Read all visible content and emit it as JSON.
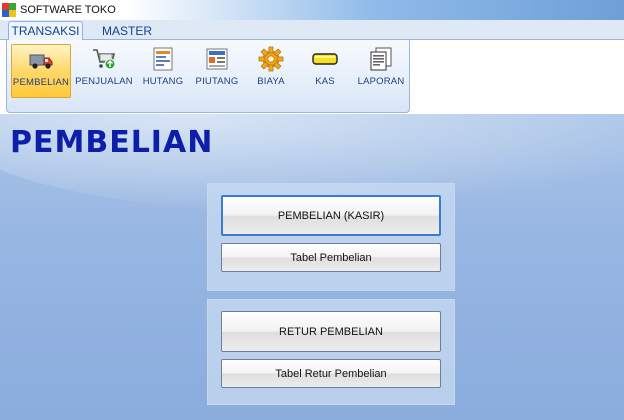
{
  "window": {
    "title": "SOFTWARE TOKO"
  },
  "tabs": [
    {
      "label": "TRANSAKSI",
      "active": true
    },
    {
      "label": "MASTER",
      "active": false
    }
  ],
  "ribbon": {
    "items": [
      {
        "label": "PEMBELIAN",
        "icon": "delivery-truck-icon",
        "active": true
      },
      {
        "label": "PENJUALAN",
        "icon": "shopping-cart-icon",
        "active": false
      },
      {
        "label": "HUTANG",
        "icon": "ledger-document-icon",
        "active": false
      },
      {
        "label": "PIUTANG",
        "icon": "receivable-card-icon",
        "active": false
      },
      {
        "label": "BIAYA",
        "icon": "gear-icon",
        "active": false
      },
      {
        "label": "KAS",
        "icon": "cash-bar-icon",
        "active": false
      },
      {
        "label": "LAPORAN",
        "icon": "report-pages-icon",
        "active": false
      }
    ]
  },
  "main": {
    "title": "PEMBELIAN",
    "panel1": {
      "primary": "PEMBELIAN (KASIR)",
      "secondary": "Tabel Pembelian"
    },
    "panel2": {
      "primary": "RETUR PEMBELIAN",
      "secondary": "Tabel Retur Pembelian"
    }
  },
  "colors": {
    "title": "#0d1fa8",
    "accent": "#3d7bd0",
    "active_ribbon": "#ffd86b"
  }
}
